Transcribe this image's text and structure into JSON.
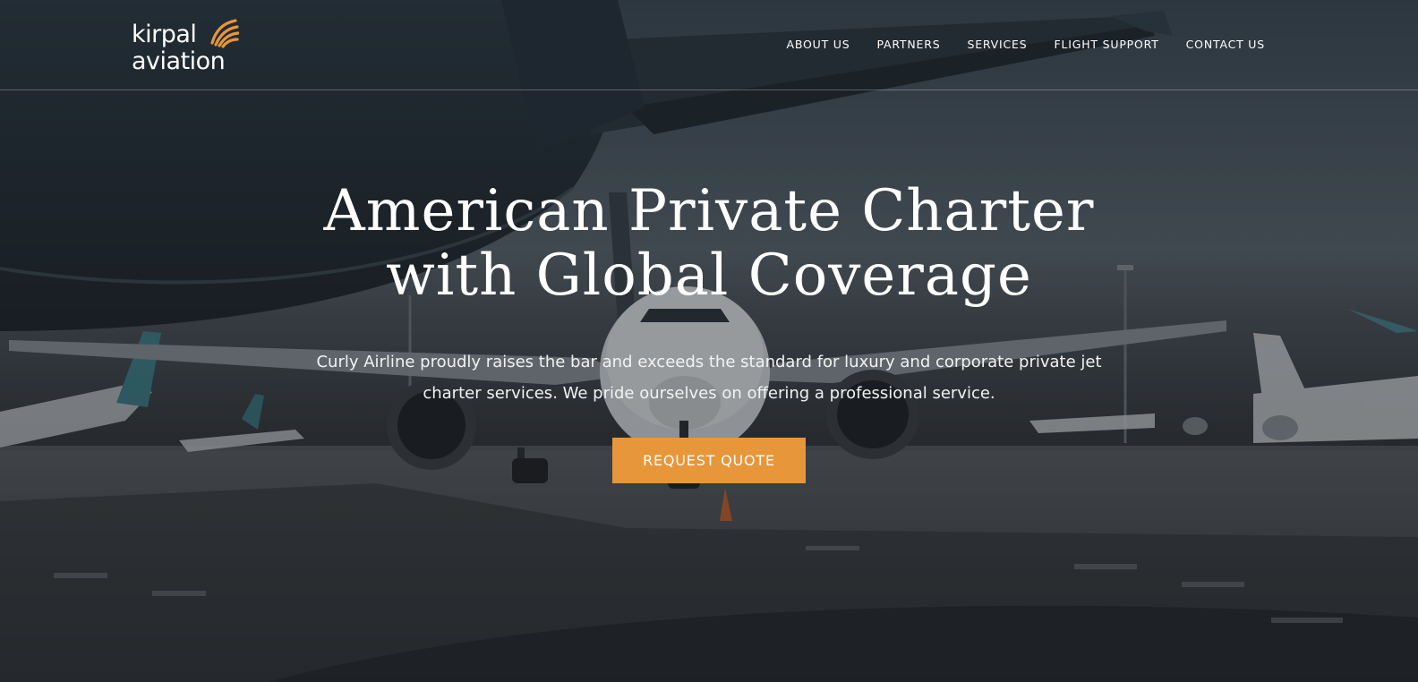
{
  "header": {
    "logo_line1": "kirpal",
    "logo_line2": "aviation",
    "nav": [
      {
        "label": "ABOUT US"
      },
      {
        "label": "PARTNERS"
      },
      {
        "label": "SERVICES"
      },
      {
        "label": "FLIGHT SUPPORT"
      },
      {
        "label": "CONTACT US"
      }
    ]
  },
  "hero": {
    "title_line1": "American Private Charter",
    "title_line2": "with Global Coverage",
    "description": "Curly Airline proudly raises the bar and exceeds the standard for luxury and corporate private jet charter services. We pride ourselves on offering a professional service.",
    "cta_label": "REQUEST QUOTE"
  },
  "colors": {
    "accent": "#e8963a",
    "background_dark": "#1c2126"
  },
  "icons": {
    "logo_mark": "orange-wing-icon"
  }
}
